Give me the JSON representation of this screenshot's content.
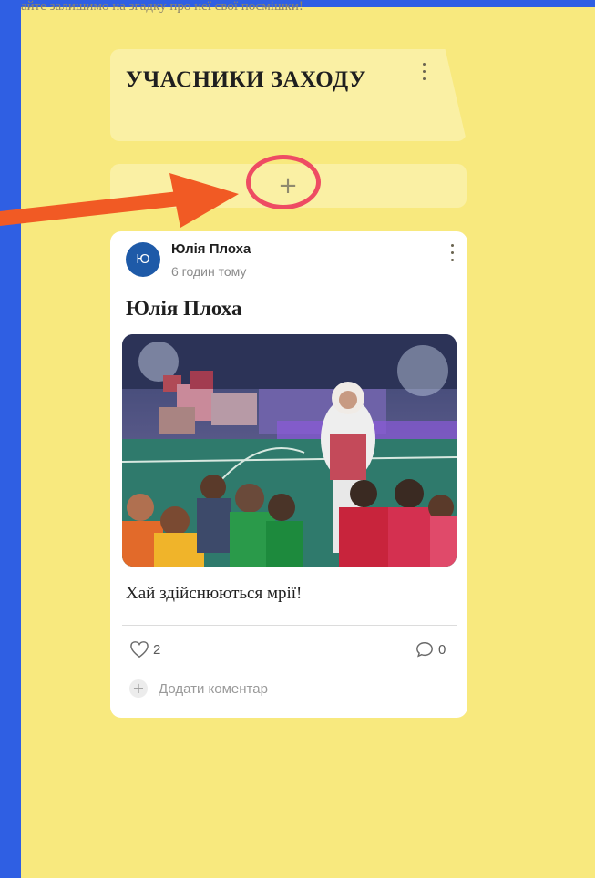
{
  "page": {
    "top_text": "айте залишимо на згадку про неї свої посмішки!"
  },
  "column": {
    "title": "УЧАСНИКИ ЗАХОДУ",
    "add_label": "+"
  },
  "post": {
    "avatar_letter": "Ю",
    "author": "Юлія Плоха",
    "time": "6 годин тому",
    "title": "Юлія Плоха",
    "caption": "Хай здійснюються мрії!",
    "likes": "2",
    "comments": "0",
    "add_comment": "Додати коментар",
    "comment_plus": "+"
  },
  "colors": {
    "board_bg": "#f8e97e",
    "frame_bg": "#2f5fe3",
    "avatar_bg": "#1e5aa8",
    "highlight": "#ee4c63",
    "arrow": "#f15a24"
  },
  "icons": [
    "more-vertical-icon",
    "plus-icon",
    "heart-icon",
    "comment-icon",
    "annotation-arrow"
  ]
}
